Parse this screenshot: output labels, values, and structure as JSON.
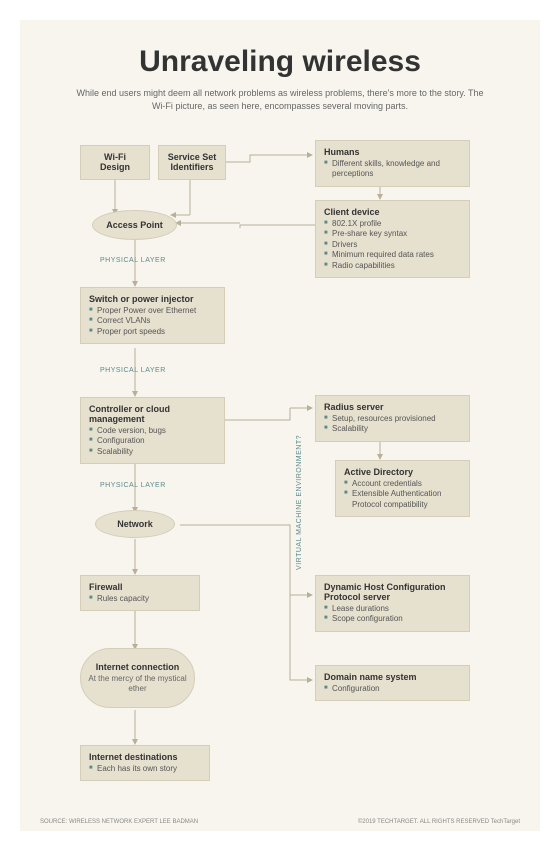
{
  "title": "Unraveling wireless",
  "subtitle": "While end users might deem all network problems as wireless problems, there's more to the story. The Wi-Fi picture, as seen here, encompasses several moving parts.",
  "wifi_design": {
    "title": "Wi-Fi Design"
  },
  "ssid": {
    "title": "Service Set Identifiers"
  },
  "humans": {
    "title": "Humans",
    "items": [
      "Different skills, knowledge and perceptions"
    ]
  },
  "access_point": {
    "title": "Access Point"
  },
  "client_device": {
    "title": "Client device",
    "items": [
      "802.1X profile",
      "Pre-share key syntax",
      "Drivers",
      "Minimum required data rates",
      "Radio capabilities"
    ]
  },
  "switch": {
    "title": "Switch or power injector",
    "items": [
      "Proper Power over Ethernet",
      "Correct VLANs",
      "Proper port speeds"
    ]
  },
  "controller": {
    "title": "Controller or cloud management",
    "items": [
      "Code version, bugs",
      "Configuration",
      "Scalability"
    ]
  },
  "radius": {
    "title": "Radius server",
    "items": [
      "Setup, resources provisioned",
      "Scalability"
    ]
  },
  "ad": {
    "title": "Active Directory",
    "items": [
      "Account credentials",
      "Extensible Authentication Protocol compatibility"
    ]
  },
  "network": {
    "title": "Network"
  },
  "firewall": {
    "title": "Firewall",
    "items": [
      "Rules capacity"
    ]
  },
  "dhcp": {
    "title": "Dynamic Host Configuration Protocol server",
    "items": [
      "Lease durations",
      "Scope configuration"
    ]
  },
  "internet": {
    "title": "Internet connection",
    "sub": "At the mercy of the mystical ether"
  },
  "dns": {
    "title": "Domain name system",
    "items": [
      "Configuration"
    ]
  },
  "destinations": {
    "title": "Internet destinations",
    "items": [
      "Each has its own story"
    ]
  },
  "layer_label": "PHYSICAL LAYER",
  "vm_label": "VIRTUAL MACHINE ENVIRONMENT?",
  "footer_left": "SOURCE: WIRELESS NETWORK EXPERT LEE BADMAN",
  "footer_right": "©2019 TECHTARGET. ALL RIGHTS RESERVED  TechTarget"
}
